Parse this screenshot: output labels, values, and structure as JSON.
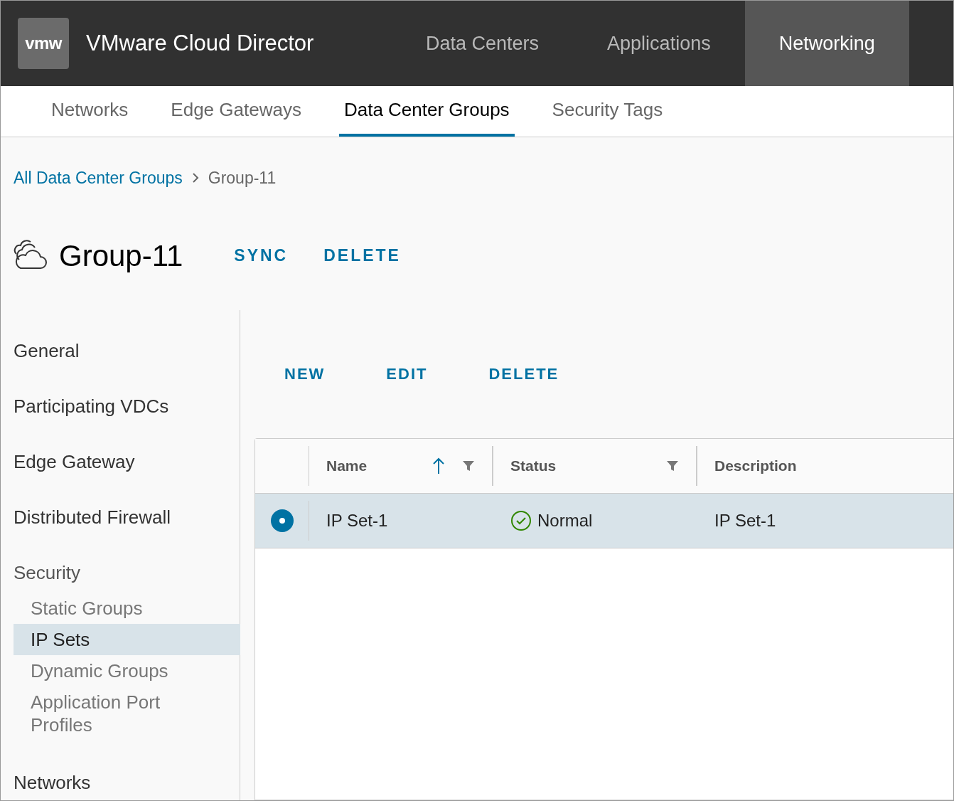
{
  "header": {
    "logo": "vmw",
    "title": "VMware Cloud Director",
    "nav": [
      {
        "label": "Data Centers",
        "selected": false
      },
      {
        "label": "Applications",
        "selected": false
      },
      {
        "label": "Networking",
        "selected": true
      }
    ]
  },
  "tabs": [
    {
      "label": "Networks",
      "selected": false
    },
    {
      "label": "Edge Gateways",
      "selected": false
    },
    {
      "label": "Data Center Groups",
      "selected": true
    },
    {
      "label": "Security Tags",
      "selected": false
    }
  ],
  "breadcrumb": {
    "link": "All Data Center Groups",
    "current": "Group-11"
  },
  "page": {
    "title": "Group-11",
    "actions": [
      "SYNC",
      "DELETE"
    ]
  },
  "sidebar": [
    {
      "label": "General",
      "kind": "item"
    },
    {
      "label": "Participating VDCs",
      "kind": "item"
    },
    {
      "label": "Edge Gateway",
      "kind": "item"
    },
    {
      "label": "Distributed Firewall",
      "kind": "item"
    },
    {
      "label": "Security",
      "kind": "group",
      "children": [
        {
          "label": "Static Groups",
          "selected": false
        },
        {
          "label": "IP Sets",
          "selected": true
        },
        {
          "label": "Dynamic Groups",
          "selected": false
        },
        {
          "label": "Application Port Profiles",
          "selected": false
        }
      ]
    },
    {
      "label": "Networks",
      "kind": "item"
    }
  ],
  "toolbar": [
    "NEW",
    "EDIT",
    "DELETE"
  ],
  "table": {
    "columns": [
      {
        "label": "Name",
        "sorted": true,
        "filter": true
      },
      {
        "label": "Status",
        "sorted": false,
        "filter": true
      },
      {
        "label": "Description",
        "sorted": false,
        "filter": false
      }
    ],
    "rows": [
      {
        "selected": true,
        "name": "IP Set-1",
        "status": "Normal",
        "description": "IP Set-1"
      }
    ]
  }
}
